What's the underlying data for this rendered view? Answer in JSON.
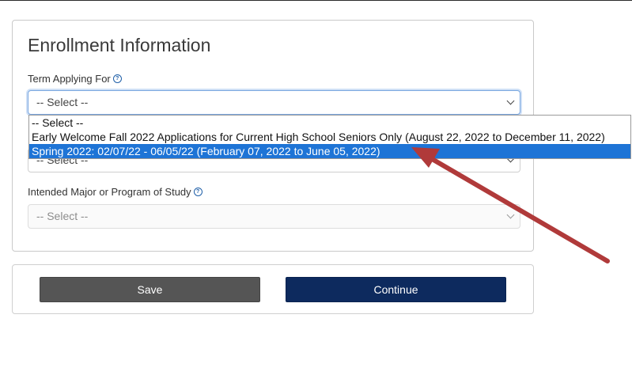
{
  "enrollment": {
    "title": "Enrollment Information",
    "term_label": "Term Applying For",
    "term_select_value": "-- Select --",
    "hidden_select_value": "-- Select --",
    "major_label": "Intended Major or Program of Study",
    "major_select_value": "-- Select --"
  },
  "term_dropdown": {
    "options": [
      "-- Select --",
      "Early Welcome Fall 2022 Applications for Current High School Seniors Only (August 22, 2022 to December 11, 2022)",
      "Spring 2022: 02/07/22 - 06/05/22 (February 07, 2022 to June 05, 2022)"
    ],
    "highlighted_index": 2
  },
  "actions": {
    "save_label": "Save",
    "continue_label": "Continue"
  },
  "icons": {
    "help": "help-circle-icon",
    "dropdown": "chevron-down-icon"
  },
  "colors": {
    "primary_button": "#0d2a5e",
    "secondary_button": "#555555",
    "option_highlight": "#1e74d6",
    "annotation_arrow": "#b03a3a"
  }
}
